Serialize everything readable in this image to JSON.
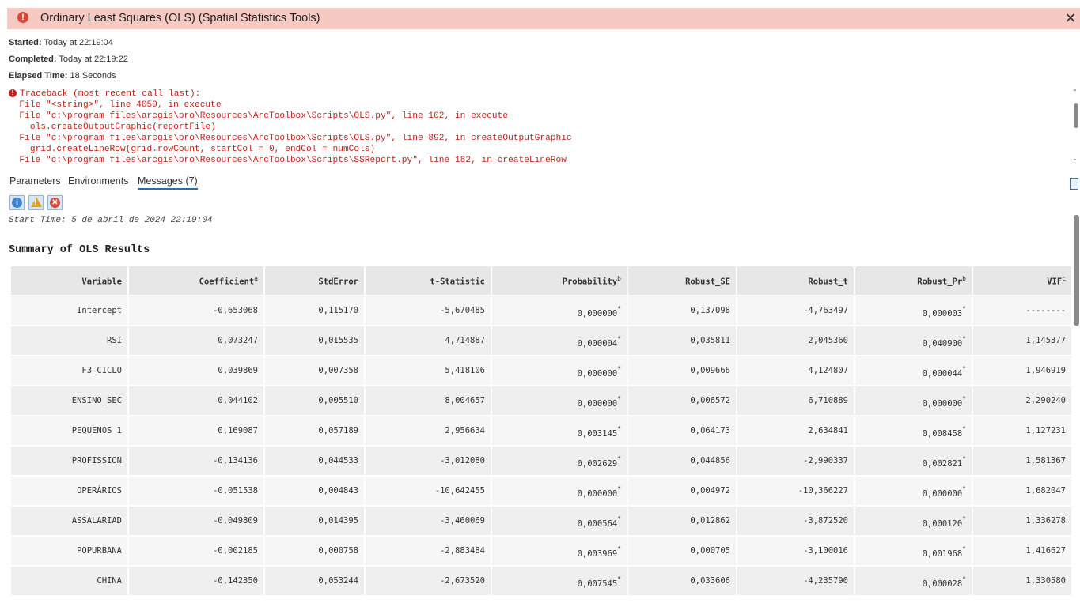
{
  "header": {
    "title": "Ordinary Least Squares (OLS) (Spatial Statistics Tools)",
    "error_icon": "error-icon",
    "close_icon": "close-icon",
    "banner_color": "#f6c9c3"
  },
  "meta": {
    "started_label": "Started:",
    "started_value": "Today at 22:19:04",
    "completed_label": "Completed:",
    "completed_value": "Today at 22:19:22",
    "elapsed_label": "Elapsed Time:",
    "elapsed_value": "18 Seconds"
  },
  "traceback": {
    "color": "#c0231c",
    "lines": [
      "Traceback (most recent call last):",
      "  File \"<string>\", line 4059, in execute",
      "  File \"c:\\program files\\arcgis\\pro\\Resources\\ArcToolbox\\Scripts\\OLS.py\", line 102, in execute",
      "    ols.createOutputGraphic(reportFile)",
      "  File \"c:\\program files\\arcgis\\pro\\Resources\\ArcToolbox\\Scripts\\OLS.py\", line 892, in createOutputGraphic",
      "    grid.createLineRow(grid.rowCount, startCol = 0, endCol = numCols)",
      "  File \"c:\\program files\\arcgis\\pro\\Resources\\ArcToolbox\\Scripts\\SSReport.py\", line 182, in createLineRow"
    ]
  },
  "tabs": [
    {
      "label": "Parameters",
      "active": false
    },
    {
      "label": "Environments",
      "active": false
    },
    {
      "label": "Messages (7)",
      "active": true
    }
  ],
  "filters": [
    {
      "name": "info-filter",
      "icon": "info-icon",
      "glyph": "i",
      "color": "#3a86d4"
    },
    {
      "name": "warning-filter",
      "icon": "warning-icon",
      "glyph": "!",
      "color": "#e3a21a"
    },
    {
      "name": "error-filter",
      "icon": "error-icon",
      "glyph": "✕",
      "color": "#d24a3c"
    }
  ],
  "messages": {
    "start_time": "Start Time: 5 de abril de 2024 22:19:04",
    "summary_title": "Summary of OLS Results"
  },
  "table": {
    "headers": [
      {
        "text": "Variable",
        "sup": ""
      },
      {
        "text": "Coefficient",
        "sup": "a"
      },
      {
        "text": "StdError",
        "sup": ""
      },
      {
        "text": "t-Statistic",
        "sup": ""
      },
      {
        "text": "Probability",
        "sup": "b"
      },
      {
        "text": "Robust_SE",
        "sup": ""
      },
      {
        "text": "Robust_t",
        "sup": ""
      },
      {
        "text": "Robust_Pr",
        "sup": "b"
      },
      {
        "text": "VIF",
        "sup": "c"
      }
    ],
    "rows": [
      [
        "Intercept",
        "-0,653068",
        "0,115170",
        "-5,670485",
        "0,000000",
        "0,137098",
        "-4,763497",
        "0,000003",
        "--------"
      ],
      [
        "RSI",
        "0,073247",
        "0,015535",
        "4,714887",
        "0,000004",
        "0,035811",
        "2,045360",
        "0,040900",
        "1,145377"
      ],
      [
        "F3_CICLO",
        "0,039869",
        "0,007358",
        "5,418106",
        "0,000000",
        "0,009666",
        "4,124807",
        "0,000044",
        "1,946919"
      ],
      [
        "ENSINO_SEC",
        "0,044102",
        "0,005510",
        "8,004657",
        "0,000000",
        "0,006572",
        "6,710889",
        "0,000000",
        "2,290240"
      ],
      [
        "PEQUENOS_1",
        "0,169087",
        "0,057189",
        "2,956634",
        "0,003145",
        "0,064173",
        "2,634841",
        "0,008458",
        "1,127231"
      ],
      [
        "PROFISSION",
        "-0,134136",
        "0,044533",
        "-3,012080",
        "0,002629",
        "0,044856",
        "-2,990337",
        "0,002821",
        "1,581367"
      ],
      [
        "OPERÁRIOS",
        "-0,051538",
        "0,004843",
        "-10,642455",
        "0,000000",
        "0,004972",
        "-10,366227",
        "0,000000",
        "1,682047"
      ],
      [
        "ASSALARIAD",
        "-0,049809",
        "0,014395",
        "-3,460069",
        "0,000564",
        "0,012862",
        "-3,872520",
        "0,000120",
        "1,336278"
      ],
      [
        "POPURBANA",
        "-0,002185",
        "0,000758",
        "-2,883484",
        "0,003969",
        "0,000705",
        "-3,100016",
        "0,001968",
        "1,416627"
      ],
      [
        "CHINA",
        "-0,142350",
        "0,053244",
        "-2,673520",
        "0,007545",
        "0,033606",
        "-4,235790",
        "0,000028",
        "1,330580"
      ]
    ],
    "significance_mark": "*"
  }
}
